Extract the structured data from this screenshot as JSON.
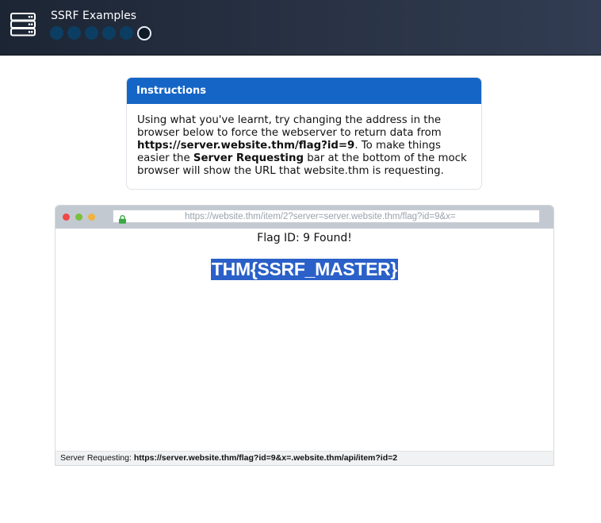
{
  "header": {
    "title": "SSRF Examples",
    "steps": {
      "total": 6,
      "current": 6
    },
    "icon": "server-stack-icon"
  },
  "instructions": {
    "title": "Instructions",
    "text_1": "Using what you've learnt, try changing the address in the browser below to force the webserver to return data from ",
    "target_url": "https://server.website.thm/flag?id=9",
    "text_2": ". To make things easier the ",
    "bar_name": "Server Requesting",
    "text_3": " bar at the bottom of the mock browser will show the URL that website.thm is requesting."
  },
  "browser": {
    "address": "https://website.thm/item/2?server=server.website.thm/flag?id=9&x=",
    "lock_icon": "lock-icon",
    "content": {
      "status": "Flag ID: 9 Found!",
      "flag": "THM{SSRF_MASTER}"
    },
    "status_bar": {
      "label": "Server Requesting: ",
      "url": "https://server.website.thm/flag?id=9&x=.website.thm/api/item?id=2"
    },
    "window_dots": [
      "#f04848",
      "#7cbf3a",
      "#f2b33b"
    ]
  },
  "colors": {
    "header_bg": "#2a3446",
    "accent": "#1565c6",
    "step_done": "#0c3e63",
    "selection": "#2a60c8"
  }
}
